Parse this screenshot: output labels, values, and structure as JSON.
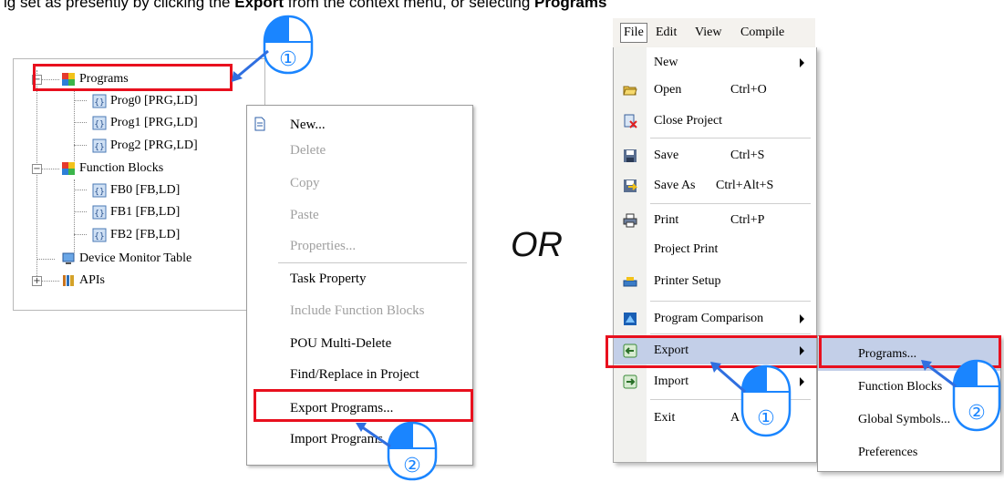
{
  "banner": {
    "pre": "ig set as presently by clicking the ",
    "em1": "Export",
    "mid": " from the context menu, or selecting ",
    "em2": "Programs"
  },
  "tree": {
    "items": [
      {
        "label": "Programs"
      },
      {
        "label": "Prog0 [PRG,LD]"
      },
      {
        "label": "Prog1 [PRG,LD]"
      },
      {
        "label": "Prog2 [PRG,LD]"
      },
      {
        "label": "Function Blocks"
      },
      {
        "label": "FB0 [FB,LD]"
      },
      {
        "label": "FB1 [FB,LD]"
      },
      {
        "label": "FB2 [FB,LD]"
      },
      {
        "label": "Device Monitor Table"
      },
      {
        "label": "APIs"
      }
    ],
    "expander_minus": "−",
    "expander_plus": "+"
  },
  "context_menu": {
    "items": [
      {
        "label": "New...",
        "enabled": true
      },
      {
        "label": "Delete",
        "enabled": false
      },
      {
        "label": "Copy",
        "enabled": false
      },
      {
        "label": "Paste",
        "enabled": false
      },
      {
        "label": "Properties...",
        "enabled": false
      },
      {
        "label": "Task Property",
        "enabled": true
      },
      {
        "label": "Include Function Blocks",
        "enabled": false
      },
      {
        "label": "POU Multi-Delete",
        "enabled": true
      },
      {
        "label": "Find/Replace in Project",
        "enabled": true
      },
      {
        "label": "Export Programs...",
        "enabled": true
      },
      {
        "label": "Import Programs",
        "enabled": true
      }
    ]
  },
  "or_label": "OR",
  "menubar": {
    "file": "File",
    "edit": "Edit",
    "view": "View",
    "compile": "Compile"
  },
  "file_menu": {
    "items": [
      {
        "label": "New",
        "shortcut": ""
      },
      {
        "label": "Open",
        "shortcut": "Ctrl+O"
      },
      {
        "label": "Close Project",
        "shortcut": ""
      },
      {
        "label": "Save",
        "shortcut": "Ctrl+S"
      },
      {
        "label": "Save As",
        "shortcut": "Ctrl+Alt+S"
      },
      {
        "label": "Print",
        "shortcut": "Ctrl+P"
      },
      {
        "label": "Project Print",
        "shortcut": ""
      },
      {
        "label": "Printer Setup",
        "shortcut": ""
      },
      {
        "label": "Program Comparison",
        "shortcut": ""
      },
      {
        "label": "Export",
        "shortcut": ""
      },
      {
        "label": "Import",
        "shortcut": ""
      },
      {
        "label": "Exit",
        "shortcut": "A"
      }
    ]
  },
  "export_submenu": {
    "items": [
      {
        "label": "Programs..."
      },
      {
        "label": "Function Blocks"
      },
      {
        "label": "Global Symbols..."
      },
      {
        "label": "Preferences"
      }
    ]
  },
  "callouts": {
    "step1": "①",
    "step2": "②"
  },
  "colors": {
    "highlight_red": "#e8101e",
    "mouse_blue": "#1a85ff",
    "arrow_blue": "#2f6fe0",
    "menu_active": "#c3cfe8"
  }
}
